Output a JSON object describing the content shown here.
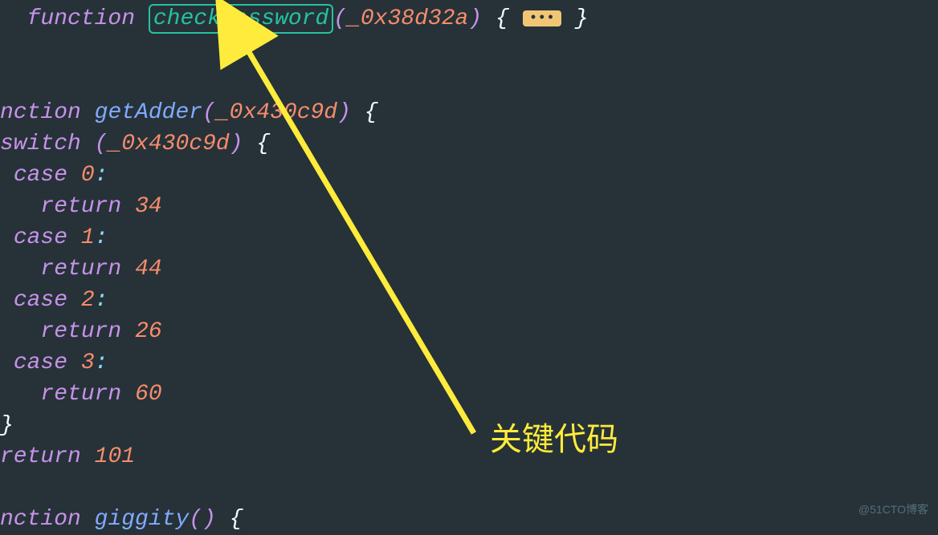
{
  "code": {
    "line1": {
      "kw": "function",
      "fn": "checkPassword",
      "param": "_0x38d32a",
      "collapsed": "•••"
    },
    "line2": {
      "kw": "nction",
      "fn": "getAdder",
      "param": "_0x430c9d"
    },
    "line3": {
      "kw": "switch",
      "var": "_0x430c9d"
    },
    "cases": [
      {
        "kw": "case",
        "val": "0",
        "ret_kw": "return",
        "ret_val": "34"
      },
      {
        "kw": "case",
        "val": "1",
        "ret_kw": "return",
        "ret_val": "44"
      },
      {
        "kw": "case",
        "val": "2",
        "ret_kw": "return",
        "ret_val": "26"
      },
      {
        "kw": "case",
        "val": "3",
        "ret_kw": "return",
        "ret_val": "60"
      }
    ],
    "close_brace": "}",
    "final_return": {
      "kw": "return",
      "val": "101"
    },
    "last_line": {
      "kw": "nction",
      "fn": "giggity"
    }
  },
  "annotation": {
    "label": "关键代码"
  },
  "watermark": "@51CTO博客"
}
